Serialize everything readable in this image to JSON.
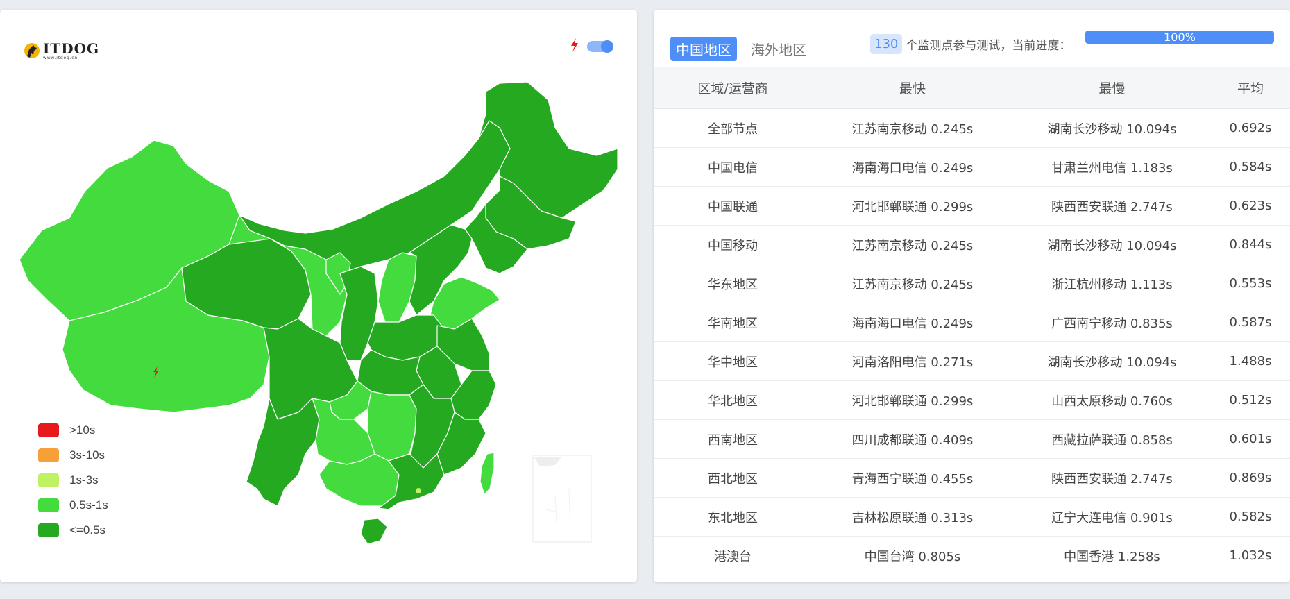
{
  "logo": {
    "main": "ITDOG",
    "sub": "www.itdog.cn"
  },
  "colors": {
    "over_10s": "#e8191d",
    "s3_10": "#f7a03a",
    "s1_3": "#bff263",
    "s05_1": "#44db3f",
    "under_05": "#24a920",
    "accent": "#4e8ef7"
  },
  "legend": [
    {
      "label": ">10s",
      "color": "#e8191d"
    },
    {
      "label": "3s-10s",
      "color": "#f7a03a"
    },
    {
      "label": "1s-3s",
      "color": "#bff263"
    },
    {
      "label": "0.5s-1s",
      "color": "#44db3f"
    },
    {
      "label": "<=0.5s",
      "color": "#24a920"
    }
  ],
  "tabs": {
    "china": "中国地区",
    "overseas": "海外地区"
  },
  "progress": {
    "node_count": "130",
    "label": "个监测点参与测试，当前进度：",
    "percent_text": "100%",
    "percent": 100
  },
  "table": {
    "headers": [
      "区域/运营商",
      "最快",
      "最慢",
      "平均"
    ],
    "rows": [
      [
        "全部节点",
        "江苏南京移动 0.245s",
        "湖南长沙移动 10.094s",
        "0.692s"
      ],
      [
        "中国电信",
        "海南海口电信 0.249s",
        "甘肃兰州电信 1.183s",
        "0.584s"
      ],
      [
        "中国联通",
        "河北邯郸联通 0.299s",
        "陕西西安联通 2.747s",
        "0.623s"
      ],
      [
        "中国移动",
        "江苏南京移动 0.245s",
        "湖南长沙移动 10.094s",
        "0.844s"
      ],
      [
        "华东地区",
        "江苏南京移动 0.245s",
        "浙江杭州移动 1.113s",
        "0.553s"
      ],
      [
        "华南地区",
        "海南海口电信 0.249s",
        "广西南宁移动 0.835s",
        "0.587s"
      ],
      [
        "华中地区",
        "河南洛阳电信 0.271s",
        "湖南长沙移动 10.094s",
        "1.488s"
      ],
      [
        "华北地区",
        "河北邯郸联通 0.299s",
        "山西太原移动 0.760s",
        "0.512s"
      ],
      [
        "西南地区",
        "四川成都联通 0.409s",
        "西藏拉萨联通 0.858s",
        "0.601s"
      ],
      [
        "西北地区",
        "青海西宁联通 0.455s",
        "陕西西安联通 2.747s",
        "0.869s"
      ],
      [
        "东北地区",
        "吉林松原联通 0.313s",
        "辽宁大连电信 0.901s",
        "0.582s"
      ],
      [
        "港澳台",
        "中国台湾 0.805s",
        "中国香港 1.258s",
        "1.032s"
      ]
    ]
  }
}
